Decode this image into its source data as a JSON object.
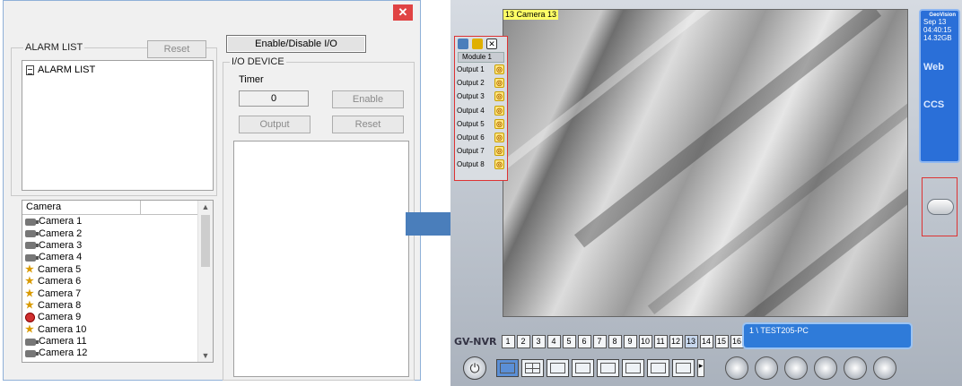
{
  "dialog": {
    "close_glyph": "✕",
    "alarm_list": {
      "group_title": "ALARM LIST",
      "reset_label": "Reset",
      "tree_root": "ALARM LIST"
    },
    "io": {
      "toggle_label": "Enable/Disable I/O",
      "group_title": "I/O DEVICE",
      "timer_label": "Timer",
      "timer_value": "0",
      "enable_label": "Enable",
      "output_label": "Output",
      "reset_label": "Reset"
    },
    "camera_list": {
      "header": "Camera",
      "cameras": [
        {
          "label": "Camera 1",
          "icon": "camera-icon"
        },
        {
          "label": "Camera 2",
          "icon": "camera-icon"
        },
        {
          "label": "Camera 3",
          "icon": "camera-icon"
        },
        {
          "label": "Camera 4",
          "icon": "camera-icon"
        },
        {
          "label": "Camera 5",
          "icon": "running-icon"
        },
        {
          "label": "Camera 6",
          "icon": "running-icon"
        },
        {
          "label": "Camera 7",
          "icon": "running-icon"
        },
        {
          "label": "Camera 8",
          "icon": "running-icon"
        },
        {
          "label": "Camera 9",
          "icon": "error-icon"
        },
        {
          "label": "Camera 10",
          "icon": "running-icon"
        },
        {
          "label": "Camera 11",
          "icon": "camera-icon"
        },
        {
          "label": "Camera 12",
          "icon": "camera-icon"
        }
      ]
    }
  },
  "nvr": {
    "camera_label": "13 Camera 13",
    "io_panel": {
      "module": "Module 1",
      "outputs": [
        "Output 1",
        "Output 2",
        "Output 3",
        "Output 4",
        "Output 5",
        "Output 6",
        "Output 7",
        "Output 8"
      ]
    },
    "side_panel": {
      "brand": "GeoVision",
      "date": "Sep 13",
      "time": "04:40:15",
      "disk": "14.32GB",
      "web": "Web",
      "ccs": "CCS"
    },
    "logo": "GV-NVR",
    "camera_numbers": [
      "1",
      "2",
      "3",
      "4",
      "5",
      "6",
      "7",
      "8",
      "9",
      "10",
      "11",
      "12",
      "13",
      "14",
      "15",
      "16"
    ],
    "selected_camera": "13",
    "host": "1 \\ TEST205-PC",
    "colors": {
      "accent": "#2f7bd9",
      "arrow": "#4a7ebb",
      "highlight": "#dd3333"
    }
  }
}
